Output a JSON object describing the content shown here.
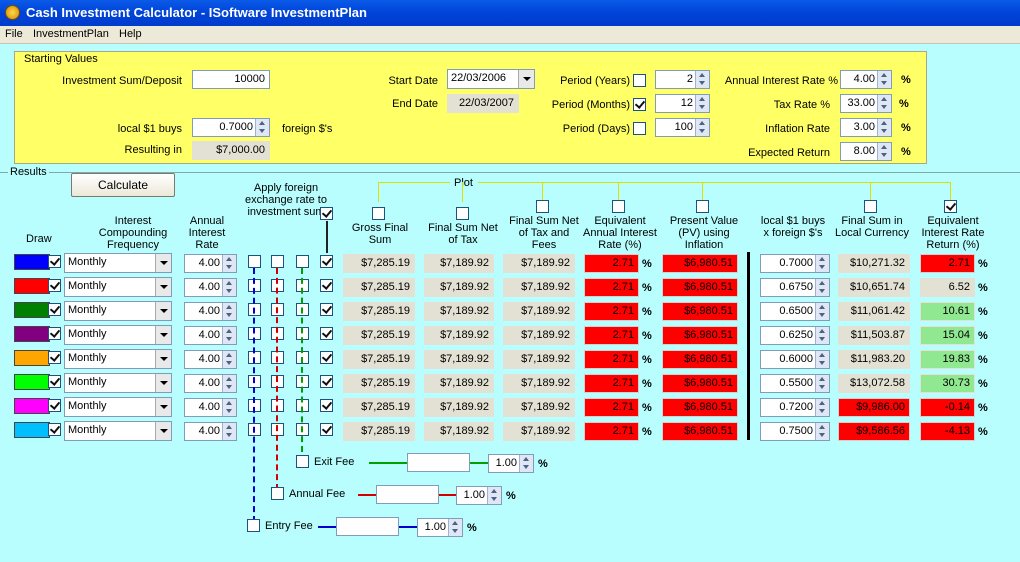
{
  "app": {
    "title": "Cash Investment Calculator - ISoftware InvestmentPlan"
  },
  "menu": [
    "File",
    "InvestmentPlan",
    "Help"
  ],
  "starting": {
    "group_label": "Starting Values",
    "investment_label": "Investment Sum/Deposit",
    "investment_value": "10000",
    "local_buys_label": "local $1 buys",
    "local_buys_value": "0.7000",
    "foreign_label": "foreign $'s",
    "resulting_label": "Resulting in",
    "resulting_value": "$7,000.00",
    "start_date_label": "Start Date",
    "start_date_value": "22/03/2006",
    "end_date_label": "End Date",
    "end_date_value": "22/03/2007",
    "period_years_label": "Period (Years)",
    "period_years_value": "2",
    "period_months_label": "Period (Months)",
    "period_months_value": "12",
    "period_days_label": "Period (Days)",
    "period_days_value": "100",
    "annual_rate_label": "Annual Interest Rate %",
    "annual_rate_value": "4.00",
    "tax_rate_label": "Tax Rate %",
    "tax_rate_value": "33.00",
    "inflation_label": "Inflation Rate",
    "inflation_value": "3.00",
    "expected_label": "Expected Return",
    "expected_value": "8.00",
    "pct": "%"
  },
  "results": {
    "group_label": "Results",
    "calculate_label": "Calculate",
    "plot_label": "Plot",
    "apply_fx_label": "Apply foreign exchange rate to investment sum",
    "headers": {
      "draw": "Draw",
      "compounding": "Interest Compounding Frequency",
      "annual_rate": "Annual Interest Rate",
      "gross": "Gross Final Sum",
      "net_tax": "Final Sum Net of Tax",
      "net_tax_fees": "Final Sum Net of Tax and Fees",
      "equiv_rate": "Equivalent Annual Interest Rate (%)",
      "pv": "Present Value (PV) using Inflation",
      "local_buys": "local $1 buys x foreign $'s",
      "final_local": "Final Sum in Local Currency",
      "equiv_return": "Equivalent Interest Rate Return (%)"
    },
    "pct": "%",
    "rows": [
      {
        "color": "#0000ff",
        "freq": "Monthly",
        "rate": "4.00",
        "gross": "$7,285.19",
        "net_tax": "$7,189.92",
        "net_fees": "$7,189.92",
        "equiv": "2.71",
        "pv": "$6,980.51",
        "fx": "0.7000",
        "final_local": "$10,271.32",
        "final_local_neg": false,
        "ret": "2.71",
        "ret_style": "red"
      },
      {
        "color": "#ff0000",
        "freq": "Monthly",
        "rate": "4.00",
        "gross": "$7,285.19",
        "net_tax": "$7,189.92",
        "net_fees": "$7,189.92",
        "equiv": "2.71",
        "pv": "$6,980.51",
        "fx": "0.6750",
        "final_local": "$10,651.74",
        "final_local_neg": false,
        "ret": "6.52",
        "ret_style": "grey"
      },
      {
        "color": "#008000",
        "freq": "Monthly",
        "rate": "4.00",
        "gross": "$7,285.19",
        "net_tax": "$7,189.92",
        "net_fees": "$7,189.92",
        "equiv": "2.71",
        "pv": "$6,980.51",
        "fx": "0.6500",
        "final_local": "$11,061.42",
        "final_local_neg": false,
        "ret": "10.61",
        "ret_style": "green"
      },
      {
        "color": "#800080",
        "freq": "Monthly",
        "rate": "4.00",
        "gross": "$7,285.19",
        "net_tax": "$7,189.92",
        "net_fees": "$7,189.92",
        "equiv": "2.71",
        "pv": "$6,980.51",
        "fx": "0.6250",
        "final_local": "$11,503.87",
        "final_local_neg": false,
        "ret": "15.04",
        "ret_style": "green"
      },
      {
        "color": "#ffa500",
        "freq": "Monthly",
        "rate": "4.00",
        "gross": "$7,285.19",
        "net_tax": "$7,189.92",
        "net_fees": "$7,189.92",
        "equiv": "2.71",
        "pv": "$6,980.51",
        "fx": "0.6000",
        "final_local": "$11,983.20",
        "final_local_neg": false,
        "ret": "19.83",
        "ret_style": "green"
      },
      {
        "color": "#00ff00",
        "freq": "Monthly",
        "rate": "4.00",
        "gross": "$7,285.19",
        "net_tax": "$7,189.92",
        "net_fees": "$7,189.92",
        "equiv": "2.71",
        "pv": "$6,980.51",
        "fx": "0.5500",
        "final_local": "$13,072.58",
        "final_local_neg": false,
        "ret": "30.73",
        "ret_style": "green"
      },
      {
        "color": "#ff00ff",
        "freq": "Monthly",
        "rate": "4.00",
        "gross": "$7,285.19",
        "net_tax": "$7,189.92",
        "net_fees": "$7,189.92",
        "equiv": "2.71",
        "pv": "$6,980.51",
        "fx": "0.7200",
        "final_local": "$9,986.00",
        "final_local_neg": true,
        "ret": "-0.14",
        "ret_style": "red"
      },
      {
        "color": "#00bfff",
        "freq": "Monthly",
        "rate": "4.00",
        "gross": "$7,285.19",
        "net_tax": "$7,189.92",
        "net_fees": "$7,189.92",
        "equiv": "2.71",
        "pv": "$6,980.51",
        "fx": "0.7500",
        "final_local": "$9,586.56",
        "final_local_neg": true,
        "ret": "-4.13",
        "ret_style": "red"
      }
    ],
    "fees": {
      "exit_label": "Exit Fee",
      "exit_value": "1.00",
      "annual_label": "Annual Fee",
      "annual_value": "1.00",
      "entry_label": "Entry Fee",
      "entry_value": "1.00"
    }
  }
}
